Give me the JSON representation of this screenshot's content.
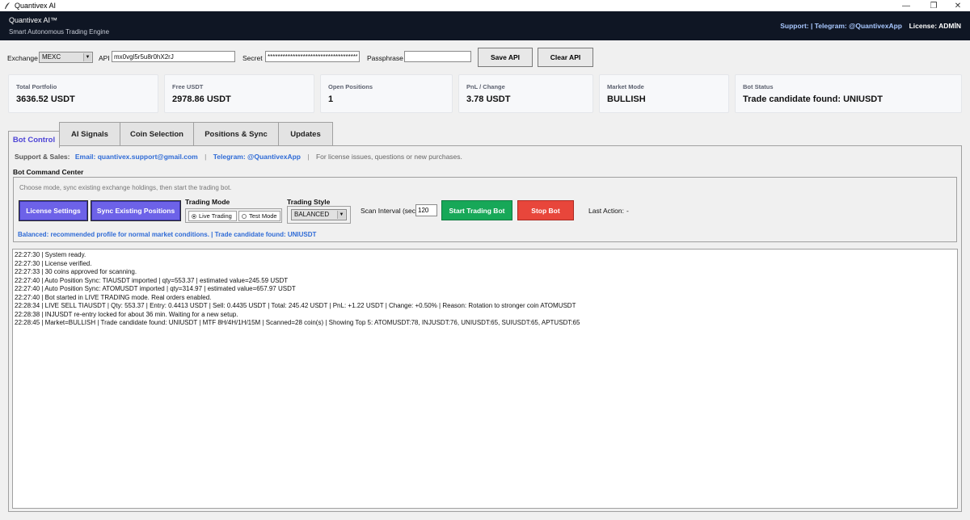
{
  "window": {
    "title": "Quantivex AI",
    "minimize": "—",
    "maximize": "❐",
    "close": "✕"
  },
  "header": {
    "brand": "Quantivex AI™",
    "tagline": "Smart Autonomous Trading Engine",
    "support": "Support:  | Telegram: @QuantivexApp",
    "license": "License: ADMİN"
  },
  "api": {
    "exchange_label": "Exchange",
    "exchange_value": "MEXC",
    "api_label": "API",
    "api_value": "mx0vgl5r5u8r0hX2rJ",
    "secret_label": "Secret",
    "secret_value": "************************************",
    "passphrase_label": "Passphrase",
    "passphrase_value": "",
    "save_label": "Save API",
    "clear_label": "Clear API"
  },
  "cards": [
    {
      "label": "Total Portfolio",
      "value": "3636.52 USDT"
    },
    {
      "label": "Free USDT",
      "value": "2978.86 USDT"
    },
    {
      "label": "Open Positions",
      "value": "1"
    },
    {
      "label": "PnL / Change",
      "value": "3.78 USDT"
    },
    {
      "label": "Market Mode",
      "value": "BULLISH"
    },
    {
      "label": "Bot Status",
      "value": "Trade candidate found: UNIUSDT"
    }
  ],
  "tabs": [
    "Bot Control",
    "AI Signals",
    "Coin Selection",
    "Positions & Sync",
    "Updates"
  ],
  "support_line": {
    "prefix": "Support & Sales:",
    "email": "Email: quantivex.support@gmail.com",
    "sep": "|",
    "telegram": "Telegram: @QuantivexApp",
    "note": "For license issues, questions or new purchases."
  },
  "command_center": {
    "title": "Bot Command Center",
    "hint": "Choose mode, sync existing exchange holdings, then start the trading bot.",
    "license_settings": "License Settings",
    "sync_positions": "Sync Existing Positions",
    "trading_mode_label": "Trading Mode",
    "mode_live": "Live Trading",
    "mode_test": "Test Mode",
    "trading_style_label": "Trading Style",
    "trading_style_value": "BALANCED",
    "scan_label": "Scan Interval (sec)",
    "scan_value": "120",
    "start_label": "Start Trading Bot",
    "stop_label": "Stop Bot",
    "last_action_label": "Last Action:",
    "last_action_value": "-",
    "status": "Balanced: recommended profile for normal market conditions. | Trade candidate found: UNIUSDT"
  },
  "log": [
    "22:27:30 | System ready.",
    "22:27:30 | License verified.",
    "22:27:33 | 30 coins approved for scanning.",
    "22:27:40 | Auto Position Sync: TIAUSDT imported | qty=553.37 | estimated value=245.59 USDT",
    "22:27:40 | Auto Position Sync: ATOMUSDT imported | qty=314.97 | estimated value=657.97 USDT",
    "22:27:40 | Bot started in LIVE TRADING mode. Real orders enabled.",
    "22:28:34 | LIVE SELL TIAUSDT | Qty: 553.37 | Entry: 0.4413 USDT | Sell: 0.4435 USDT | Total: 245.42 USDT | PnL: +1.22 USDT | Change: +0.50% | Reason: Rotation to stronger coin ATOMUSDT",
    "22:28:38 | INJUSDT re-entry locked for about 36 min. Waiting for a new setup.",
    "22:28:45 | Market=BULLISH | Trade candidate found: UNIUSDT | MTF 8H/4H/1H/15M | Scanned=28 coin(s) | Showing Top 5: ATOMUSDT:78, INJUSDT:76, UNIUSDT:65, SUIUSDT:65, APTUSDT:65"
  ],
  "colors": {
    "header_bg": "#0f1624",
    "accent_purple": "#6d62e8",
    "start_green": "#17a858",
    "stop_red": "#e8463b",
    "link_blue": "#2f6bd6"
  }
}
